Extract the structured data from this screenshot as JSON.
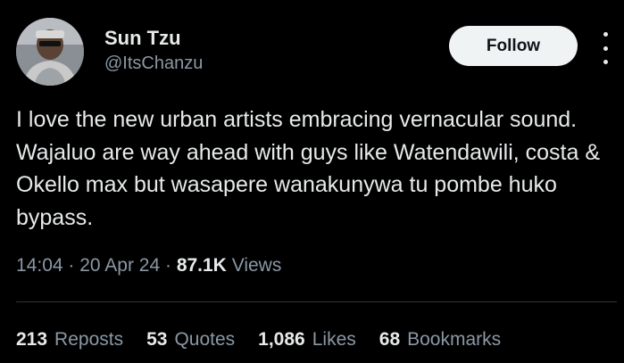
{
  "author": {
    "name": "Sun Tzu",
    "handle": "@ItsChanzu"
  },
  "follow_label": "Follow",
  "tweet_text": "I love the new urban artists embracing vernacular sound. Wajaluo are way ahead with guys like Watendawili, costa &  Okello max but wasapere wanakunywa tu pombe huko bypass.",
  "meta": {
    "time": "14:04",
    "date": "20 Apr 24",
    "views_count": "87.1K",
    "views_label": "Views"
  },
  "stats": [
    {
      "count": "213",
      "label": "Reposts"
    },
    {
      "count": "53",
      "label": "Quotes"
    },
    {
      "count": "1,086",
      "label": "Likes"
    },
    {
      "count": "68",
      "label": "Bookmarks"
    }
  ],
  "icons": {
    "more": "more-icon"
  }
}
